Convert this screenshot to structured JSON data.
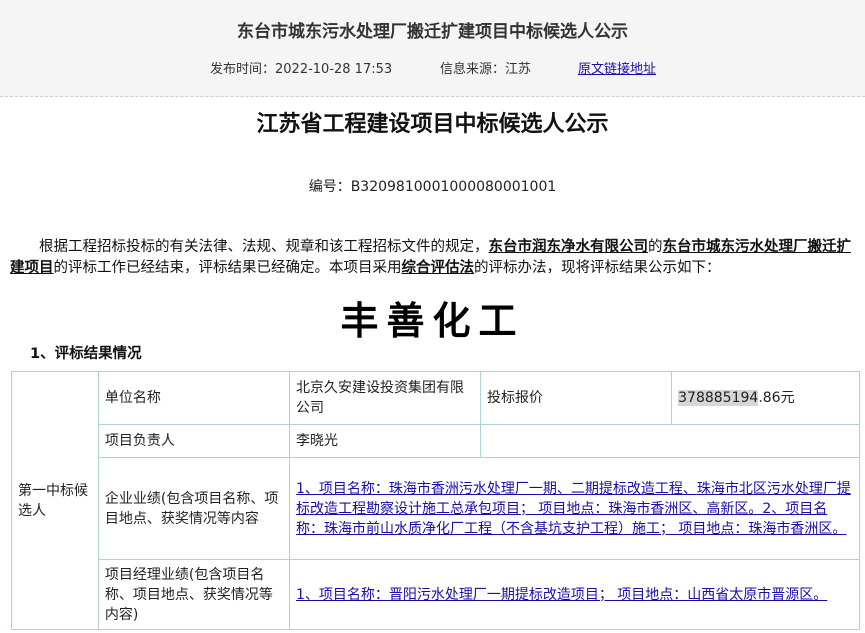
{
  "header": {
    "title": "东台市城东污水处理厂搬迁扩建项目中标候选人公示",
    "publish_time": "发布时间：2022-10-28 17:53",
    "source": "信息来源：江苏",
    "original_link": "原文链接地址"
  },
  "doc": {
    "title": "江苏省工程建设项目中标候选人公示",
    "serial": "编号：B3209810001000080001001",
    "para_part1": "根据工程招标投标的有关法律、法规、规章和该工程招标文件的规定，",
    "tenderer": "东台市润东净水有限公司",
    "para_part2": "的",
    "project": "东台市城东污水处理厂搬迁扩建项目",
    "para_part3": "的评标工作已经结束，评标结果已经确定。本项目采用",
    "method": "综合评估法",
    "para_part4": "的评标办法，现将评标结果公示如下：",
    "watermark": "丰善化工",
    "section_title": "1、评标结果情况"
  },
  "table": {
    "rank_label": "第一中标候选人",
    "company_label": "单位名称",
    "company_name": "北京久安建设投资集团有限公司",
    "bid_label": "投标报价",
    "bid_value_highlight": "378885194",
    "bid_value_rest": ".86元",
    "manager_label": "项目负责人",
    "manager_name": "李晓光",
    "company_perf_label": "企业业绩(包含项目名称、项目地点、获奖情况等内容",
    "company_perf_value": "1、项目名称：珠海市香洲污水处理厂一期、二期提标改造工程、珠海市北区污水处理厂提标改造工程勘察设计施工总承包项目； 项目地点：珠海市香洲区、高新区。2、项目名称：珠海市前山水质净化厂工程（不含基坑支护工程）施工； 项目地点：珠海市香洲区。",
    "manager_perf_label": "项目经理业绩(包含项目名称、项目地点、获奖情况等内容)",
    "manager_perf_value": "1、项目名称：晋阳污水处理厂一期提标改造项目； 项目地点：山西省太原市晋源区。"
  }
}
